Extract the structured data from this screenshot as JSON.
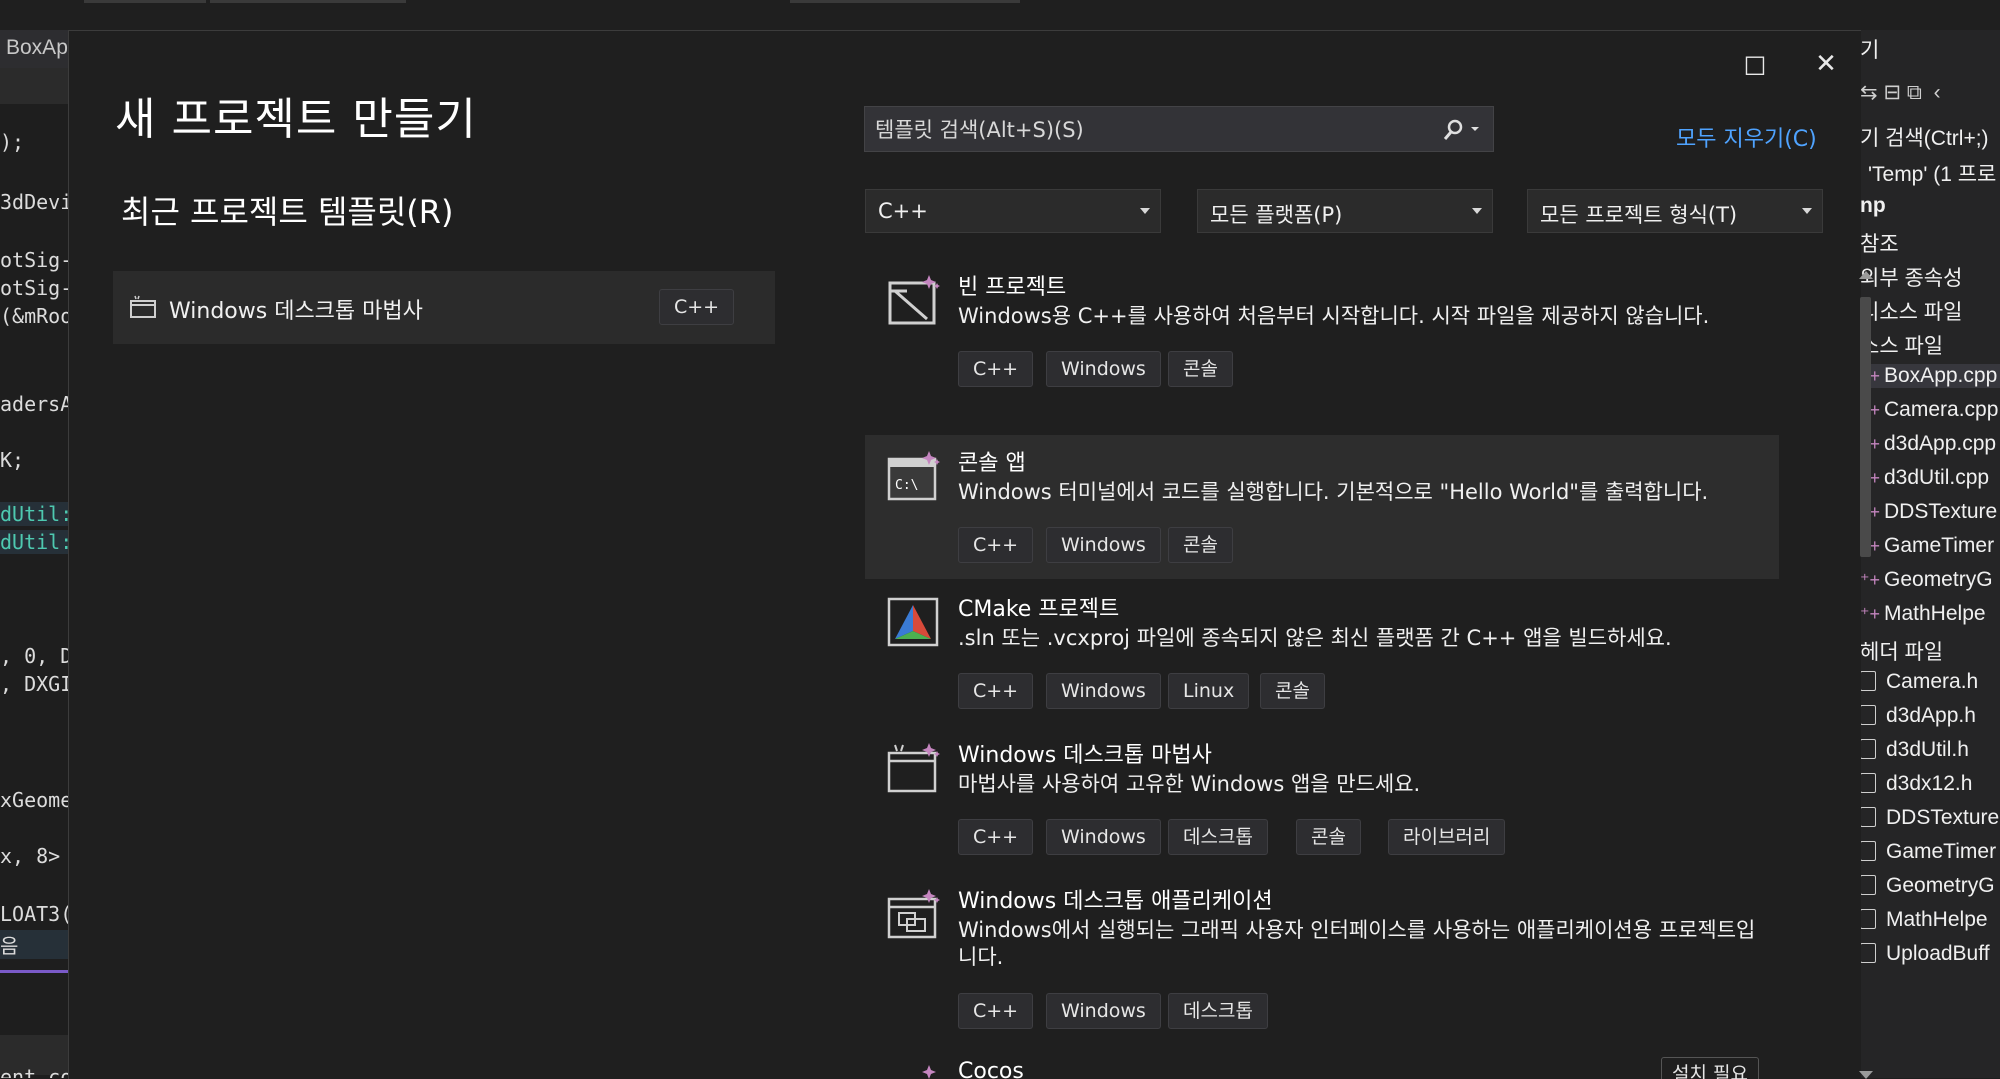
{
  "ide": {
    "editor_tab_title": "BoxAp",
    "code_lines": [
      ");",
      "3dDevi",
      "otSig-",
      "otSig-",
      "(&mRoo",
      "adersA",
      "K;",
      "dUtil:",
      "dUtil:",
      ", 0, D",
      ", DXGI",
      "xGeome",
      "x, 8>",
      "LOAT3(",
      "음",
      "ent.co"
    ],
    "solution": {
      "header_partial": "기",
      "search_partial": "기 검색(Ctrl+;)",
      "solution_partial": "'Temp' (1 프로",
      "project_partial": "np",
      "items": [
        "참조",
        "외부 종속성",
        "리소스 파일",
        "소스 파일"
      ],
      "source_files": [
        "BoxApp.cpp",
        "Camera.cpp",
        "d3dApp.cpp",
        "d3dUtil.cpp",
        "DDSTexture",
        "GameTimer",
        "GeometryG",
        "MathHelpe"
      ],
      "header_folder": "헤더 파일",
      "header_files": [
        "Camera.h",
        "d3dApp.h",
        "d3dUtil.h",
        "d3dx12.h",
        "DDSTexture",
        "GameTimer",
        "GeometryG",
        "MathHelpe",
        "UploadBuff"
      ]
    }
  },
  "dialog": {
    "title": "새 프로젝트 만들기",
    "maximize_icon": "□",
    "close_icon": "✕",
    "recent": {
      "heading": "최근 프로젝트 템플릿(R)",
      "items": [
        {
          "label": "Windows 데스크톱 마법사",
          "tag": "C++"
        }
      ]
    },
    "search": {
      "placeholder": "템플릿 검색(Alt+S)(S)",
      "value": ""
    },
    "clear_all": "모두 지우기(C)",
    "filters": {
      "language": "C++",
      "platform": "모든 플랫폼(P)",
      "project_type": "모든 프로젝트 형식(T)"
    },
    "templates": [
      {
        "name": "빈 프로젝트",
        "desc": "Windows용 C++를 사용하여 처음부터 시작합니다. 시작 파일을 제공하지 않습니다.",
        "tags": [
          "C++",
          "Windows",
          "콘솔"
        ]
      },
      {
        "name": "콘솔 앱",
        "desc": "Windows 터미널에서 코드를 실행합니다. 기본적으로 \"Hello World\"를 출력합니다.",
        "tags": [
          "C++",
          "Windows",
          "콘솔"
        ],
        "icon_text": "C:\\"
      },
      {
        "name": "CMake 프로젝트",
        "desc": ".sln 또는 .vcxproj 파일에 종속되지 않은 최신 플랫폼 간 C++ 앱을 빌드하세요.",
        "tags": [
          "C++",
          "Windows",
          "Linux",
          "콘솔"
        ]
      },
      {
        "name": "Windows 데스크톱 마법사",
        "desc": "마법사를 사용하여 고유한 Windows 앱을 만드세요.",
        "tags": [
          "C++",
          "Windows",
          "데스크톱",
          "콘솔",
          "라이브러리"
        ]
      },
      {
        "name": "Windows 데스크톱 애플리케이션",
        "desc": "Windows에서 실행되는 그래픽 사용자 인터페이스를 사용하는 애플리케이션용 프로젝트입니다.",
        "tags": [
          "C++",
          "Windows",
          "데스크톱"
        ]
      },
      {
        "name": "Cocos",
        "desc": "",
        "tags": [],
        "install_label": "설치 필요"
      }
    ]
  }
}
